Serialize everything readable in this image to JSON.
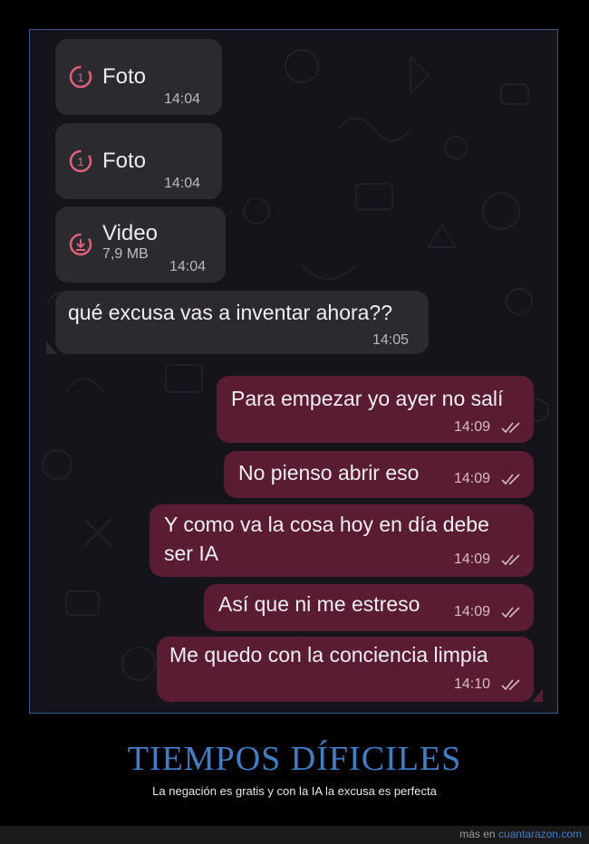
{
  "chat": {
    "messages": [
      {
        "type": "media",
        "icon": "view-once-icon",
        "title": "Foto",
        "time": "14:04"
      },
      {
        "type": "media",
        "icon": "view-once-icon",
        "title": "Foto",
        "time": "14:04"
      },
      {
        "type": "media",
        "icon": "download-icon",
        "title": "Video",
        "size": "7,9 MB",
        "time": "14:04"
      },
      {
        "type": "text",
        "direction": "in",
        "text": "qué excusa vas a inventar ahora??",
        "time": "14:05"
      },
      {
        "type": "text",
        "direction": "out",
        "text": "Para empezar yo ayer no salí",
        "time": "14:09"
      },
      {
        "type": "text",
        "direction": "out",
        "text": "No pienso abrir eso",
        "time": "14:09"
      },
      {
        "type": "text",
        "direction": "out",
        "text_line1": "Y como va la cosa hoy en día debe",
        "text_line2": "ser IA",
        "time": "14:09"
      },
      {
        "type": "text",
        "direction": "out",
        "text": "Así que ni me estreso",
        "time": "14:09"
      },
      {
        "type": "text",
        "direction": "out",
        "text": "Me quedo con la conciencia limpia",
        "time": "14:10"
      }
    ],
    "colors": {
      "incoming": "#2a2a2f",
      "outgoing": "#5a1c33",
      "accent_icon": "#e0607a"
    }
  },
  "caption": {
    "title": "TIEMPOS DÍFICILES",
    "subtitle": "La negación es gratis y con la IA la excusa es perfecta"
  },
  "footer": {
    "prefix": "más en",
    "site": "cuantarazon.com"
  }
}
